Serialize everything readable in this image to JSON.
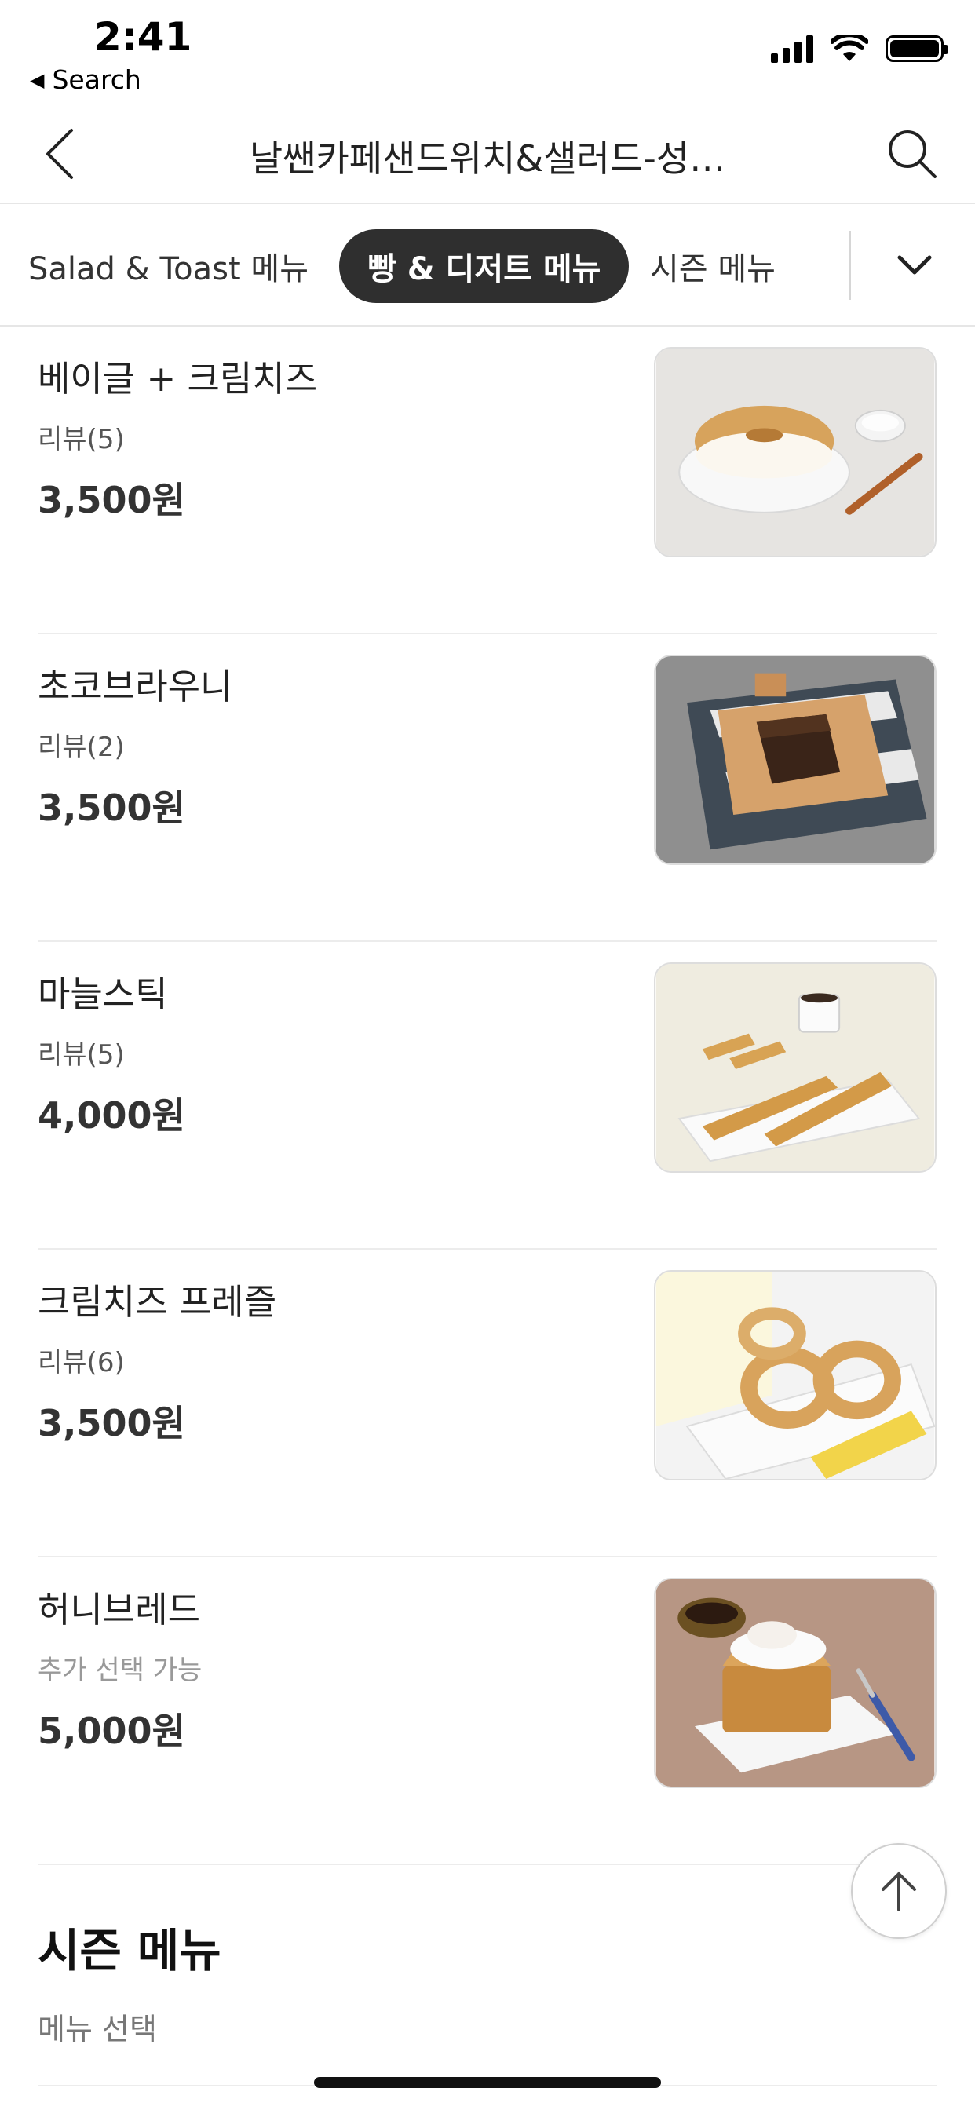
{
  "status_bar": {
    "time": "2:41",
    "back_label": "Search",
    "battery_level": 1.0
  },
  "header": {
    "title": "날쌘카페샌드위치&샐러드-성…"
  },
  "tabs": [
    {
      "label": "Salad & Toast 메뉴",
      "active": false
    },
    {
      "label": "빵 & 디저트 메뉴",
      "active": true
    },
    {
      "label": "시즌 메뉴",
      "active": false
    }
  ],
  "menu_items": [
    {
      "name": "베이글 + 크림치즈",
      "sub": "리뷰(5)",
      "price": "3,500원"
    },
    {
      "name": "초코브라우니",
      "sub": "리뷰(2)",
      "price": "3,500원"
    },
    {
      "name": "마늘스틱",
      "sub": "리뷰(5)",
      "price": "4,000원"
    },
    {
      "name": "크림치즈 프레즐",
      "sub": "리뷰(6)",
      "price": "3,500원"
    },
    {
      "name": "허니브레드",
      "sub": "추가 선택 가능",
      "price": "5,000원"
    }
  ],
  "season": {
    "title": "시즌 메뉴",
    "subtitle": "메뉴 선택"
  },
  "colors": {
    "active_tab_bg": "#2f2f2f",
    "divider": "#ececec"
  }
}
